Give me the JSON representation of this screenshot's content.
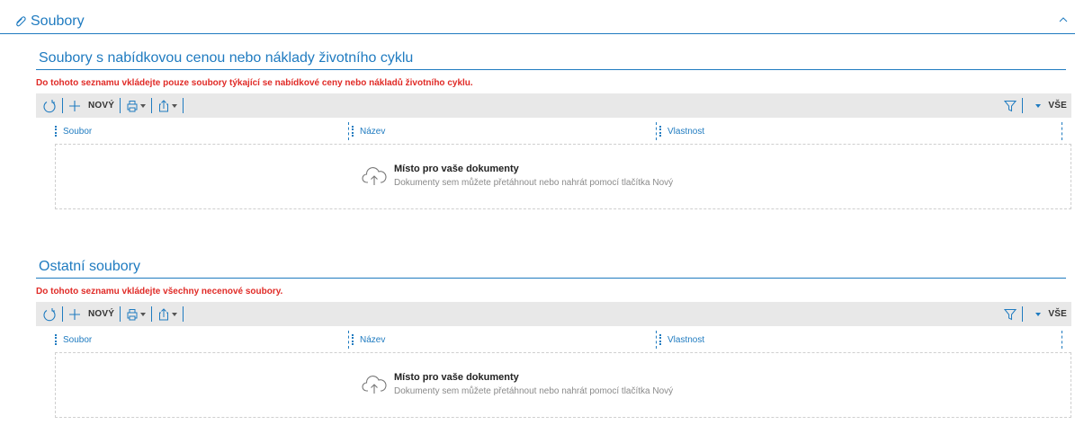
{
  "main": {
    "title": "Soubory",
    "icon": "attachment-icon",
    "collapse_icon": "chevron-up-icon"
  },
  "sections": [
    {
      "title": "Soubory s nabídkovou cenou nebo náklady životního cyklu",
      "note": "Do tohoto seznamu vkládejte pouze soubory týkající se nabídkové ceny nebo nákladů životního cyklu.",
      "toolbar": {
        "new_label": "NOVÝ",
        "filter_label": "VŠE"
      },
      "columns": [
        "Soubor",
        "Název",
        "Vlastnost"
      ],
      "drop": {
        "title": "Místo pro vaše dokumenty",
        "hint": "Dokumenty sem můžete přetáhnout nebo nahrát pomocí tlačítka Nový"
      }
    },
    {
      "title": "Ostatní soubory",
      "note": "Do tohoto seznamu vkládejte všechny necenové soubory.",
      "toolbar": {
        "new_label": "NOVÝ",
        "filter_label": "VŠE"
      },
      "columns": [
        "Soubor",
        "Název",
        "Vlastnost"
      ],
      "drop": {
        "title": "Místo pro vaše dokumenty",
        "hint": "Dokumenty sem můžete přetáhnout nebo nahrát pomocí tlačítka Nový"
      }
    }
  ],
  "colors": {
    "accent": "#1f7bc0",
    "warning": "#e02b27",
    "toolbar_bg": "#e8e8e8"
  }
}
